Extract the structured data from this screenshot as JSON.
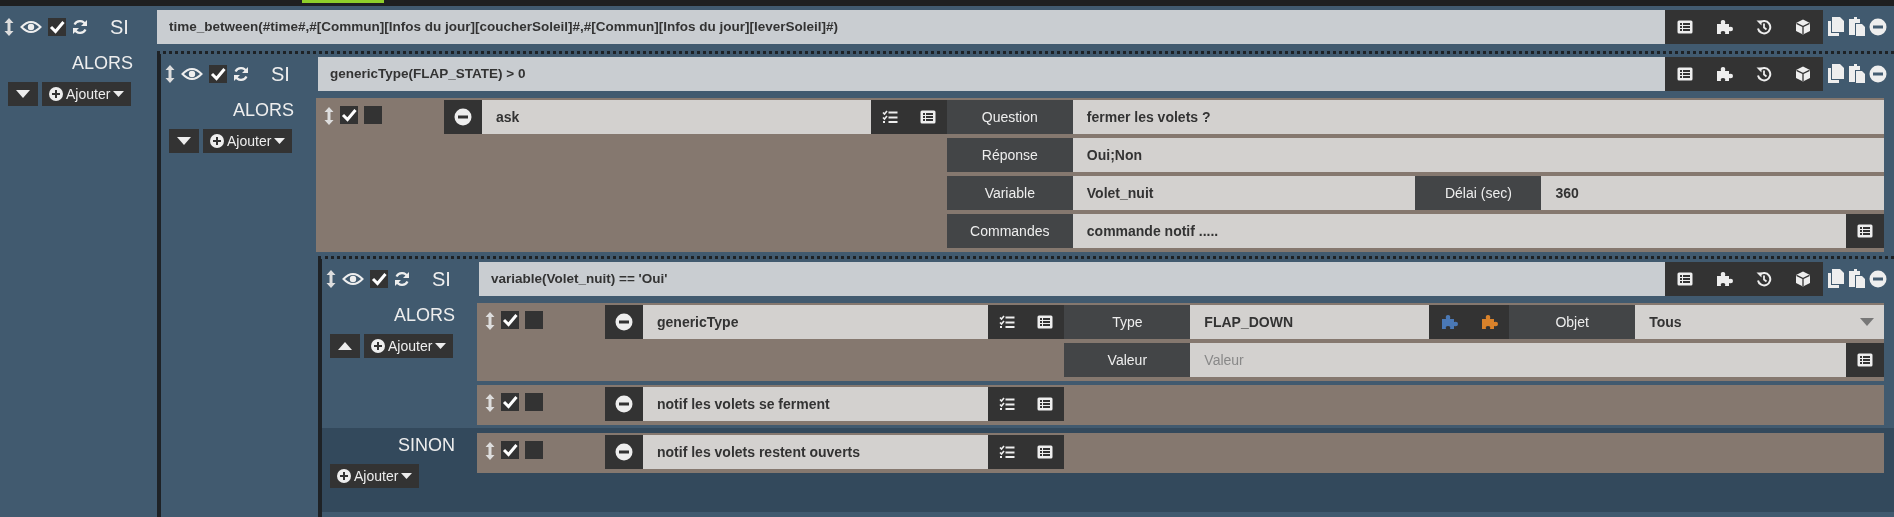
{
  "block": {
    "keyword": "SI",
    "enabled": true,
    "condition": "time_between(#time#,#[Commun][Infos du jour][coucherSoleil]#,#[Commun][Infos du jour][leverSoleil]#)",
    "then_label": "ALORS",
    "expanded": false,
    "add_label": "Ajouter",
    "then": [
      {
        "kind": "block",
        "keyword": "SI",
        "enabled": true,
        "condition": "genericType(FLAP_STATE) > 0",
        "then_label": "ALORS",
        "expanded": false,
        "add_label": "Ajouter",
        "then": [
          {
            "kind": "action",
            "enabled": true,
            "parallel": false,
            "expression": "ask",
            "options": [
              [
                {
                  "kind": "label",
                  "text": "Question"
                },
                {
                  "kind": "value",
                  "text": "fermer les volets ?"
                }
              ],
              [
                {
                  "kind": "label",
                  "text": "Réponse"
                },
                {
                  "kind": "value",
                  "text": "Oui;Non"
                }
              ],
              [
                {
                  "kind": "label",
                  "text": "Variable"
                },
                {
                  "kind": "value",
                  "text": "Volet_nuit"
                },
                {
                  "kind": "label",
                  "text": "Délai (sec)"
                },
                {
                  "kind": "value",
                  "text": "360"
                }
              ],
              [
                {
                  "kind": "label",
                  "text": "Commandes"
                },
                {
                  "kind": "value",
                  "text": "commande notif ....."
                },
                {
                  "kind": "list-button"
                }
              ]
            ]
          },
          {
            "kind": "block",
            "keyword": "SI",
            "enabled": true,
            "condition": "variable(Volet_nuit) == 'Oui'",
            "then_label": "ALORS",
            "expanded": true,
            "add_label": "Ajouter",
            "then": [
              {
                "kind": "action",
                "enabled": true,
                "parallel": false,
                "expression": "genericType",
                "options": [
                  [
                    {
                      "kind": "label",
                      "text": "Type"
                    },
                    {
                      "kind": "value",
                      "text": "FLAP_DOWN"
                    },
                    {
                      "kind": "puzzle-buttons"
                    },
                    {
                      "kind": "label",
                      "text": "Objet"
                    },
                    {
                      "kind": "select",
                      "text": "Tous"
                    }
                  ],
                  [
                    {
                      "kind": "label",
                      "text": "Valeur"
                    },
                    {
                      "kind": "input",
                      "placeholder": "Valeur"
                    },
                    {
                      "kind": "list-button"
                    }
                  ]
                ]
              },
              {
                "kind": "action",
                "enabled": true,
                "parallel": false,
                "expression": "notif les volets se ferment"
              }
            ],
            "else_label": "SINON",
            "else_add_label": "Ajouter",
            "else": [
              {
                "kind": "action",
                "enabled": true,
                "parallel": false,
                "expression": "notif les volets restent ouverts"
              }
            ]
          }
        ]
      }
    ]
  }
}
